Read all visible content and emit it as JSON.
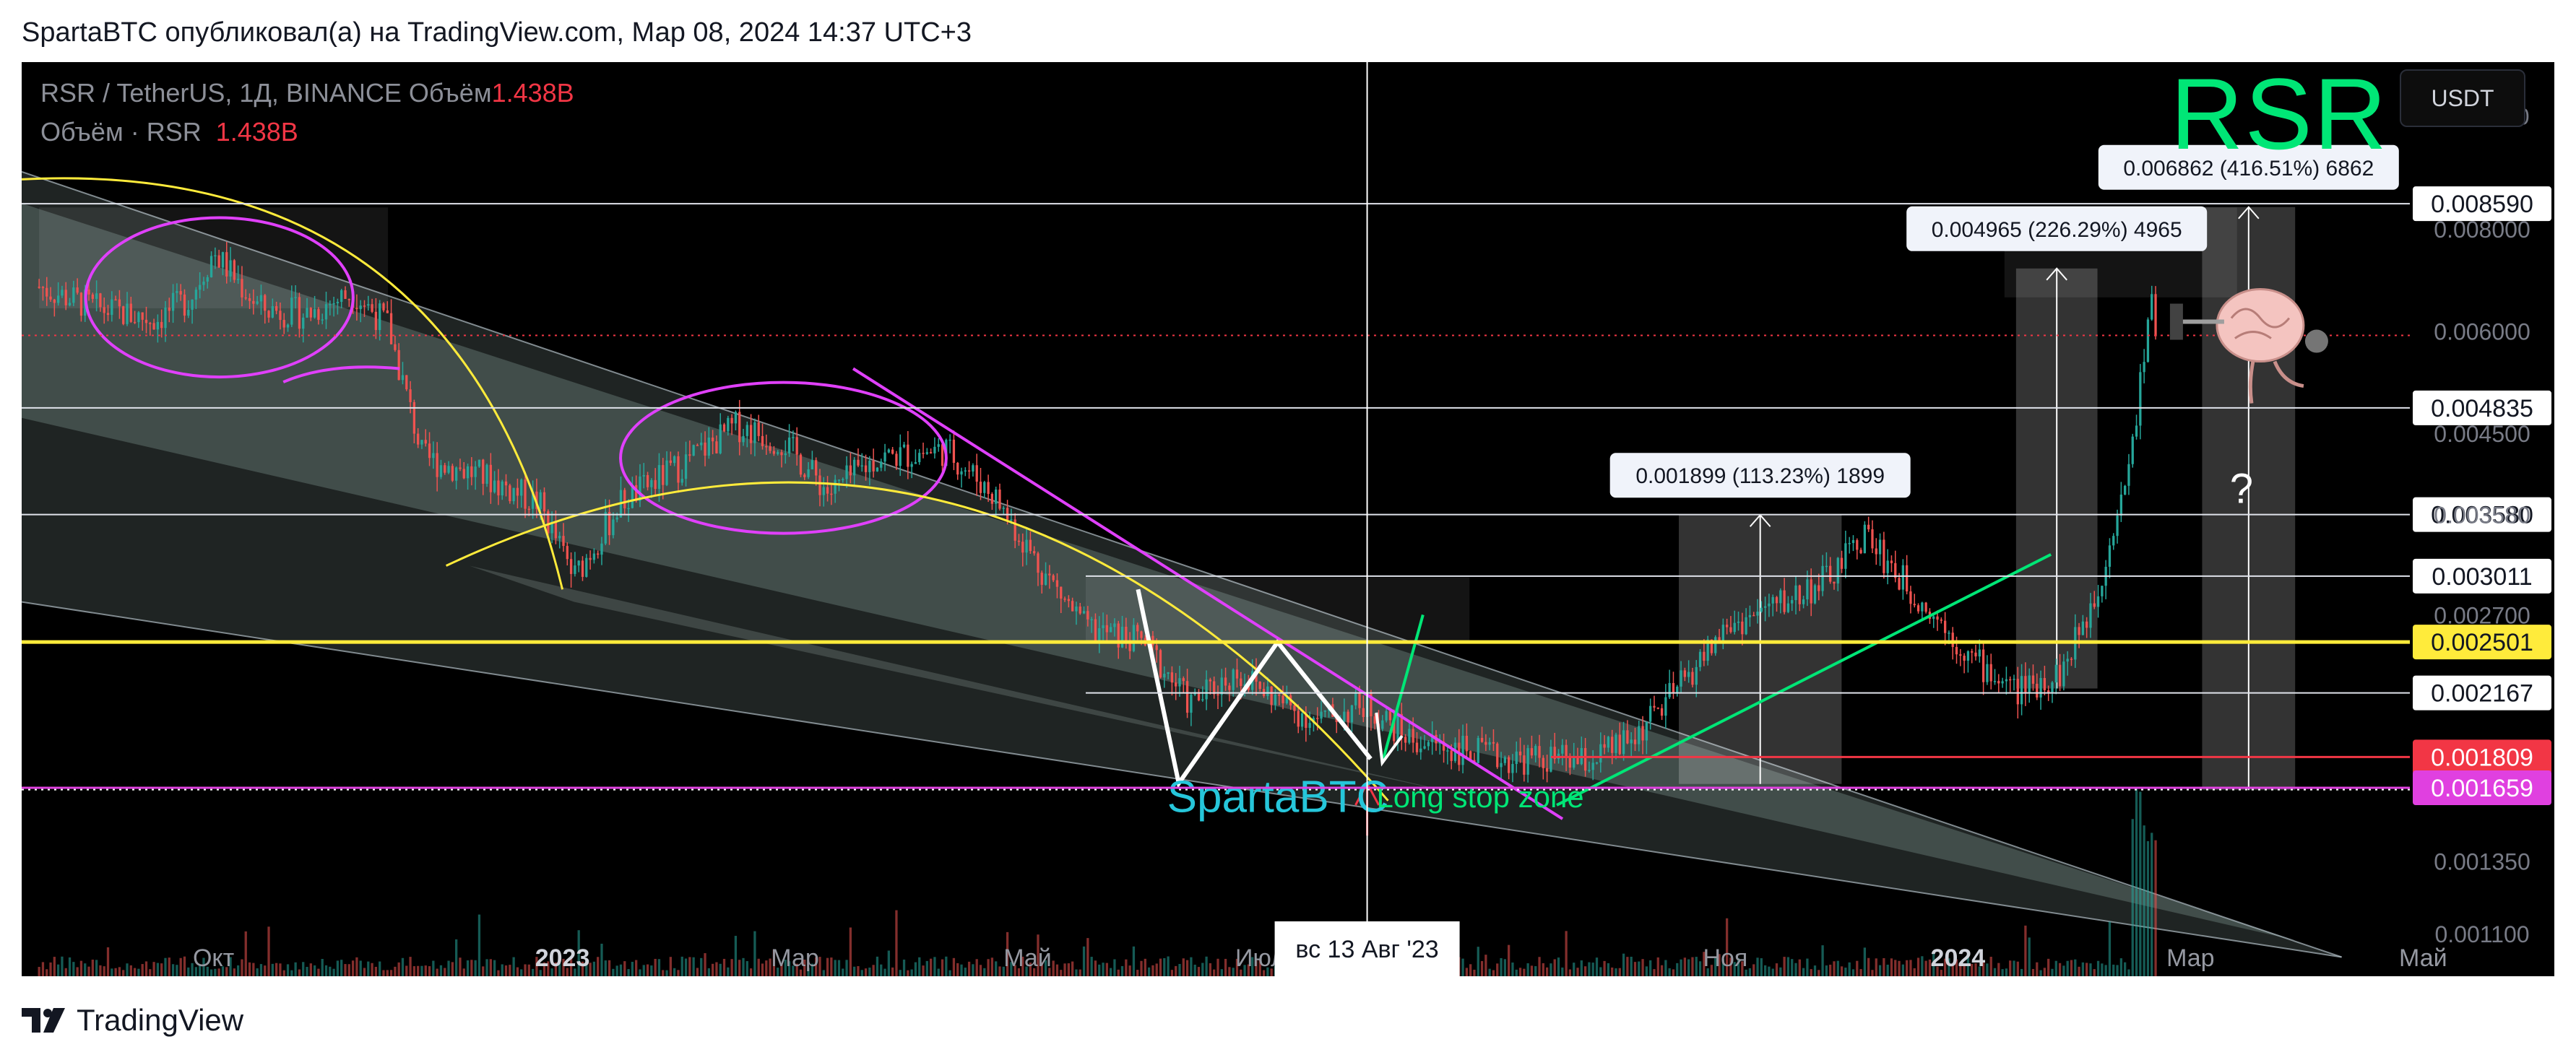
{
  "header": {
    "text": "SpartaBTC опубликовал(а) на TradingView.com, Мар 08, 2024 14:37 UTC+3"
  },
  "footer": {
    "brand": "TradingView"
  },
  "legend": {
    "symbol_line": "RSR / TetherUS, 1Д, BINANCE  Объём",
    "symbol_volume": "1.438B",
    "volume_line": "Объём · RSR",
    "volume_value": "1.438B"
  },
  "ticker_big": "RSR",
  "currency_button": "USDT",
  "colors": {
    "background": "#000000",
    "up": "#26a69a",
    "down": "#ef5350",
    "accent_green": "#00e676",
    "magenta": "#e040fb",
    "yellow_line": "#ffeb3b",
    "support_red": "#f23645",
    "support_magenta": "#e040e0"
  },
  "chart_data": {
    "type": "candlestick",
    "title": "RSR",
    "symbol": "RSR / TetherUS",
    "interval": "1Д",
    "exchange": "BINANCE",
    "y_scale": "log",
    "ylim": [
      0.00105,
      0.0118
    ],
    "x_ticks": [
      "Окт",
      "2023",
      "Мар",
      "Май",
      "Июл",
      "Ноя",
      "2024",
      "Мар",
      "Май"
    ],
    "x_tick_months": [
      9,
      12,
      14,
      16,
      18,
      22,
      24,
      26,
      28
    ],
    "crosshair_label": "вс 13 Авг '23",
    "crosshair_month": 19.42,
    "price_ticks": [
      "0.011000",
      "0.008000",
      "0.006000",
      "0.004500",
      "0.003580",
      "0.002700",
      "0.001350",
      "0.001100"
    ],
    "price_tick_values": [
      0.011,
      0.008,
      0.006,
      0.0045,
      0.00358,
      0.0027,
      0.00135,
      0.0011
    ],
    "price_levels": [
      {
        "label": "0.008590",
        "value": 0.00859,
        "style": "white"
      },
      {
        "label": "0.004835",
        "value": 0.004835,
        "style": "white"
      },
      {
        "label": "0.003580",
        "value": 0.00358,
        "style": "white"
      },
      {
        "label": "0.003011",
        "value": 0.003011,
        "style": "white"
      },
      {
        "label": "0.002501",
        "value": 0.002501,
        "style": "yellow"
      },
      {
        "label": "0.002167",
        "value": 0.002167,
        "style": "white"
      },
      {
        "label": "0.001809",
        "value": 0.001809,
        "style": "red"
      },
      {
        "label": "0.001659",
        "value": 0.001659,
        "style": "magenta"
      }
    ],
    "measurements": [
      {
        "label": "0.001899 (113.23%) 1899",
        "from": 0.001677,
        "to": 0.003576,
        "start_month": 22.1,
        "end_month": 23.5
      },
      {
        "label": "0.004965 (226.29%) 4965",
        "from": 0.002194,
        "to": 0.007159,
        "start_month": 25.0,
        "end_month": 25.7
      },
      {
        "label": "0.006862 (416.51%) 6862",
        "from": 0.001648,
        "to": 0.00851,
        "start_month": 26.6,
        "end_month": 27.4
      }
    ],
    "price_path": [
      [
        8.0,
        0.0068
      ],
      [
        8.5,
        0.0064
      ],
      [
        9.0,
        0.0062
      ],
      [
        9.3,
        0.0066
      ],
      [
        9.5,
        0.0075
      ],
      [
        9.9,
        0.0064
      ],
      [
        10.3,
        0.0063
      ],
      [
        10.7,
        0.0067
      ],
      [
        11.0,
        0.0061
      ],
      [
        11.3,
        0.0042
      ],
      [
        11.8,
        0.004
      ],
      [
        12.3,
        0.0037
      ],
      [
        12.6,
        0.003
      ],
      [
        13.0,
        0.0037
      ],
      [
        13.5,
        0.0041
      ],
      [
        14.0,
        0.0046
      ],
      [
        14.4,
        0.0044
      ],
      [
        14.8,
        0.0038
      ],
      [
        15.2,
        0.0042
      ],
      [
        15.8,
        0.0043
      ],
      [
        16.2,
        0.0038
      ],
      [
        16.6,
        0.0031
      ],
      [
        17.0,
        0.0026
      ],
      [
        17.5,
        0.0025
      ],
      [
        17.9,
        0.0021
      ],
      [
        18.3,
        0.0023
      ],
      [
        18.7,
        0.0021
      ],
      [
        19.0,
        0.002
      ],
      [
        19.4,
        0.0021
      ],
      [
        19.8,
        0.0019
      ],
      [
        20.2,
        0.00185
      ],
      [
        20.6,
        0.0018
      ],
      [
        21.0,
        0.0018
      ],
      [
        21.3,
        0.00178
      ],
      [
        21.7,
        0.0019
      ],
      [
        22.1,
        0.0022
      ],
      [
        22.5,
        0.0026
      ],
      [
        23.0,
        0.0028
      ],
      [
        23.4,
        0.003
      ],
      [
        23.7,
        0.0034
      ],
      [
        24.0,
        0.003
      ],
      [
        24.3,
        0.0027
      ],
      [
        24.6,
        0.0024
      ],
      [
        25.0,
        0.00218
      ],
      [
        25.4,
        0.0023
      ],
      [
        25.7,
        0.0029
      ],
      [
        26.0,
        0.0043
      ],
      [
        26.15,
        0.0066
      ],
      [
        26.2,
        0.0061
      ]
    ],
    "annotations": [
      {
        "type": "text",
        "text": "SpartaBTC",
        "color": "#26c6da"
      },
      {
        "type": "text",
        "text": "Long stop zone",
        "color": "#00e676"
      },
      {
        "type": "text",
        "text": "?",
        "color": "#ffffff"
      }
    ]
  }
}
